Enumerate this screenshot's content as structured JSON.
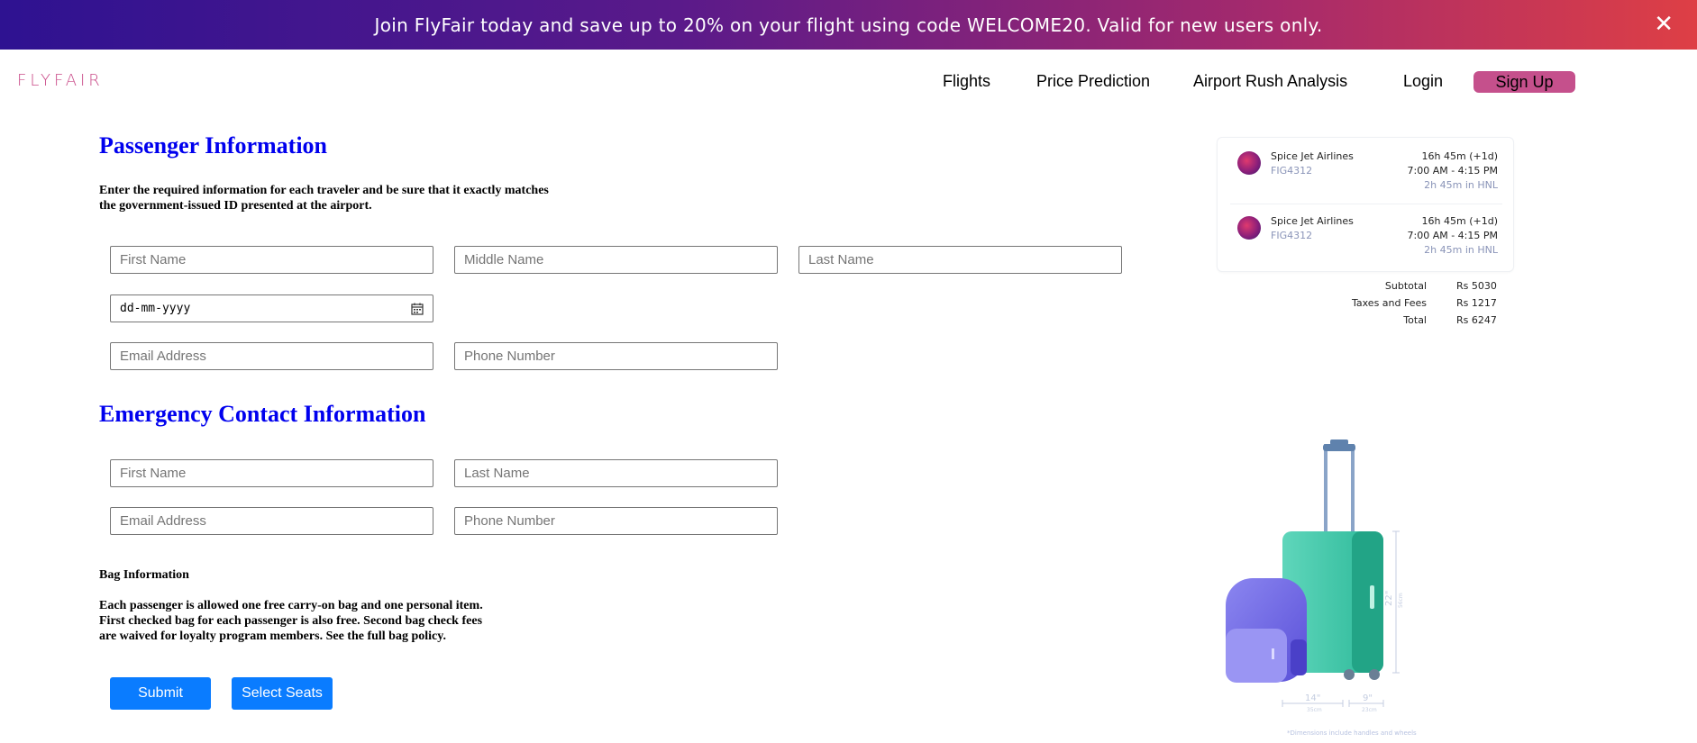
{
  "banner": {
    "text": "Join FlyFair today and save up to 20% on your flight using code WELCOME20. Valid for new users only.",
    "close_label": "✕"
  },
  "nav": {
    "logo": "FLYFAIR",
    "links": [
      "Flights",
      "Price Prediction",
      "Airport Rush Analysis",
      "Login"
    ],
    "signup": "Sign Up"
  },
  "passenger": {
    "title": "Passenger Information",
    "description_line1": "Enter the required information for each traveler and be sure that it exactly matches",
    "description_line2": "the government-issued ID presented at the airport.",
    "first_name_placeholder": "First Name",
    "middle_name_placeholder": "Middle Name",
    "last_name_placeholder": "Last Name",
    "dob_placeholder": "dd-mm-yyyy",
    "email_placeholder": "Email Address",
    "phone_placeholder": "Phone Number"
  },
  "emergency": {
    "title": "Emergency Contact Information",
    "first_name_placeholder": "First Name",
    "last_name_placeholder": "Last Name",
    "email_placeholder": "Email Address",
    "phone_placeholder": "Phone Number"
  },
  "bag": {
    "title": "Bag Information",
    "line1": "Each passenger is allowed one free carry-on bag and one personal item.",
    "line2": "First checked bag for each passenger is also free. Second bag check fees",
    "line3": "are waived for loyalty program members. See the full bag policy."
  },
  "buttons": {
    "submit": "Submit",
    "select_seats": "Select Seats"
  },
  "flights": [
    {
      "airline": "Spice Jet Airlines",
      "code": "FIG4312",
      "duration": "16h 45m (+1d)",
      "time": "7:00 AM - 4:15 PM",
      "layover": "2h 45m in HNL"
    },
    {
      "airline": "Spice Jet Airlines",
      "code": "FIG4312",
      "duration": "16h 45m (+1d)",
      "time": "7:00 AM - 4:15 PM",
      "layover": "2h 45m in HNL"
    }
  ],
  "summary": {
    "subtotal_label": "Subtotal",
    "subtotal": "Rs 5030",
    "taxes_label": "Taxes and Fees",
    "taxes": "Rs 1217",
    "total_label": "Total",
    "total": "Rs 6247"
  },
  "luggage": {
    "height_label": "22\"",
    "height_cm": "56cm",
    "width_label": "14\"",
    "width_cm": "35cm",
    "depth_label": "9\"",
    "depth_cm": "23cm",
    "caption": "*Dimensions include handles and wheels"
  },
  "colors": {
    "primary_blue": "#0a7cff",
    "heading_blue": "#0000ee",
    "brand_pink": "#c5508c"
  }
}
